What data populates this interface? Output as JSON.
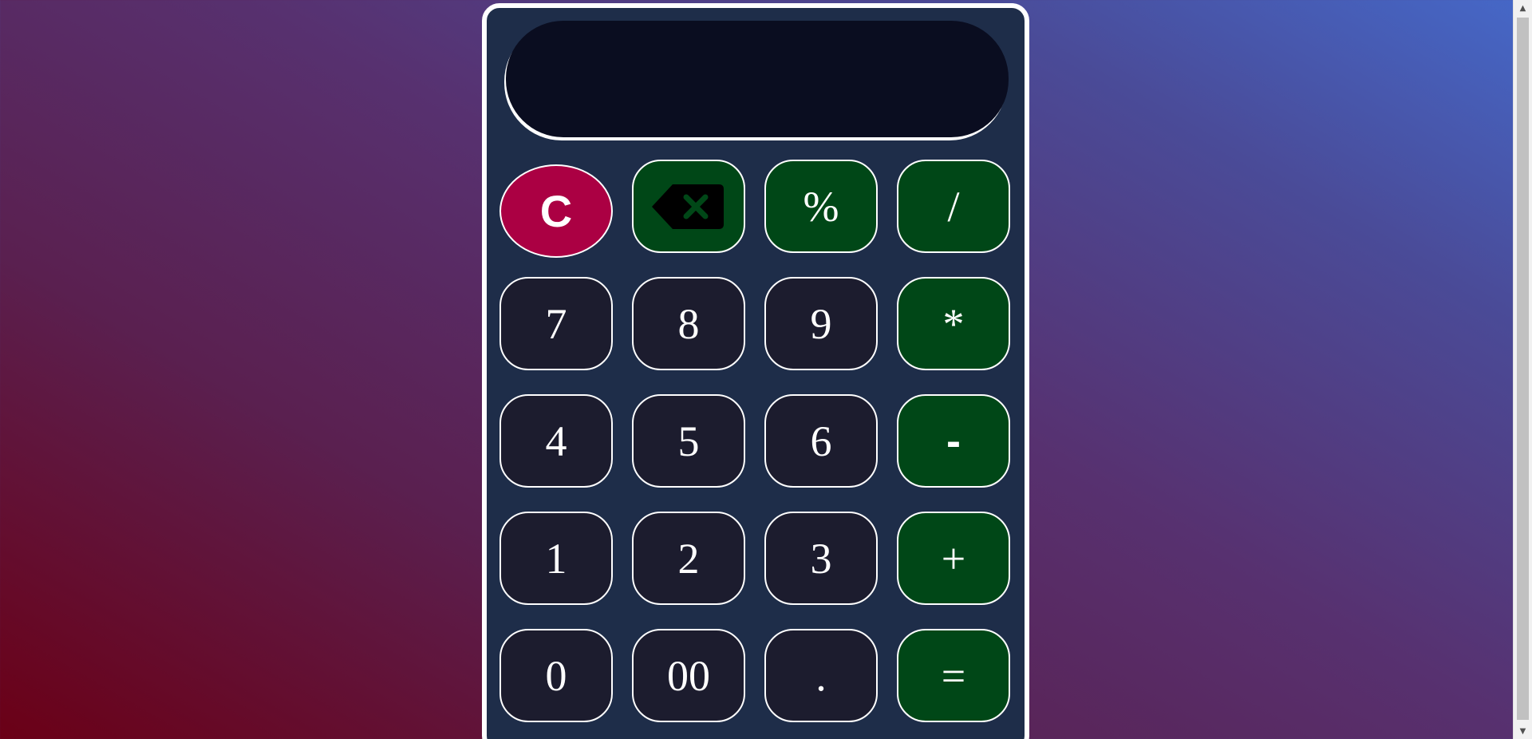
{
  "calculator": {
    "display_value": "",
    "buttons": {
      "clear": "C",
      "backspace_icon": "backspace-icon",
      "percent": "%",
      "divide": "/",
      "seven": "7",
      "eight": "8",
      "nine": "9",
      "multiply": "*",
      "four": "4",
      "five": "5",
      "six": "6",
      "minus": "-",
      "one": "1",
      "two": "2",
      "three": "3",
      "plus": "+",
      "zero": "0",
      "double_zero": "00",
      "decimal": ".",
      "equals": "="
    },
    "colors": {
      "body_bg": "#1e2d49",
      "display_bg": "#0a0d20",
      "digit_bg": "#1c1c2e",
      "operator_bg": "#004717",
      "clear_bg": "#ab0043",
      "border": "#ffffff"
    }
  }
}
